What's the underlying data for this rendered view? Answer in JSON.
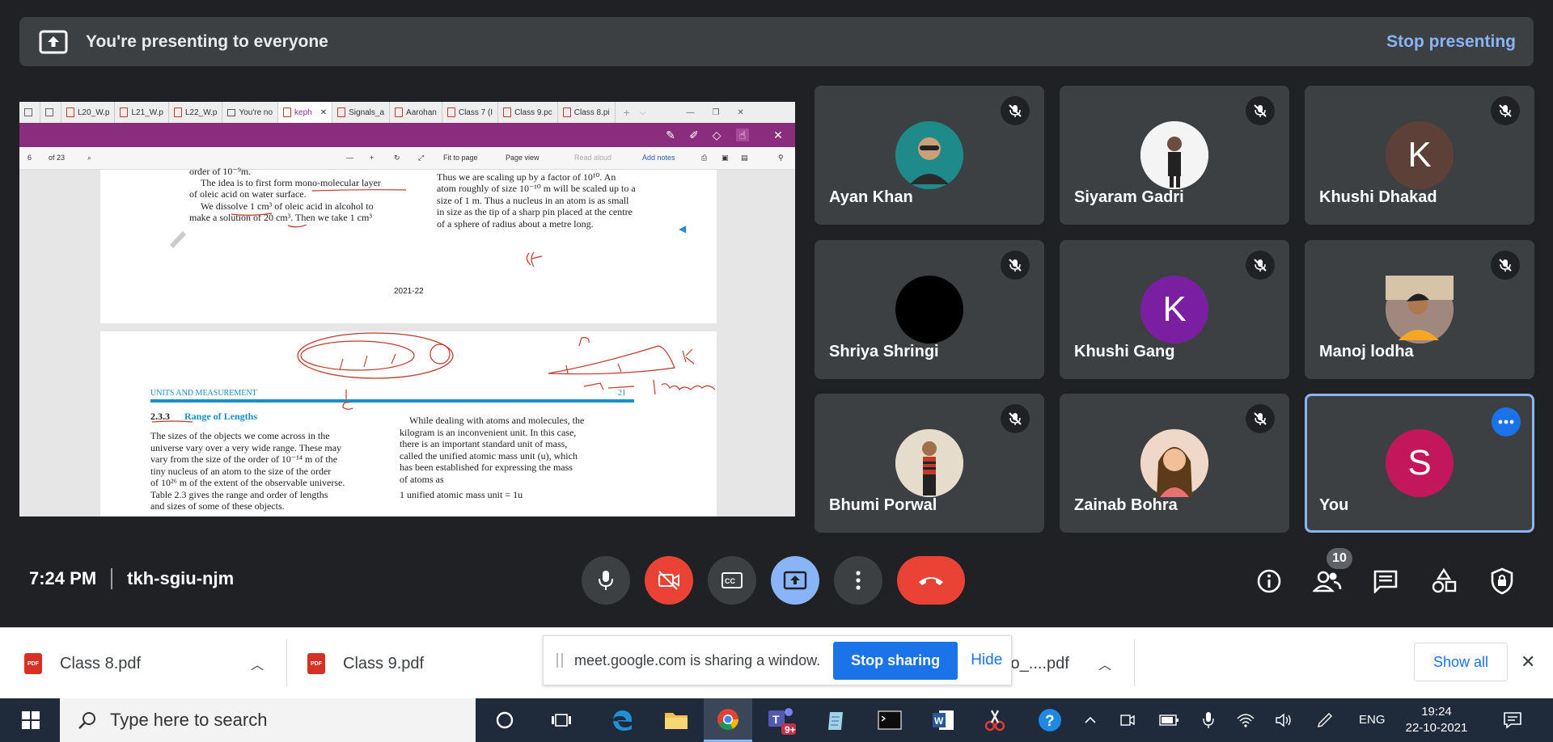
{
  "banner": {
    "title": "You're presenting to everyone",
    "stop_label": "Stop presenting"
  },
  "shared_window": {
    "tabs": [
      "L20_W.p",
      "L21_W.p",
      "L22_W.p",
      "You're no",
      "keph",
      "Signals_a",
      "Aarohan",
      "Class 7 (I",
      "Class 9.pc",
      "Class 8.pi"
    ],
    "active_tab_index": 4,
    "toolbar": {
      "page": "6",
      "of": "of 23",
      "fit": "Fit to page",
      "view": "Page view",
      "read": "Read aloud",
      "notes": "Add notes"
    },
    "page1": {
      "left": [
        "order of 10⁻⁹m.",
        "The idea is to first form mono-molecular layer",
        "of oleic acid on water surface.",
        "We dissolve 1 cm³ of oleic acid in alcohol to",
        "make a solution of 20 cm³. Then we take 1 cm³"
      ],
      "right": [
        "Thus we are scaling up by a factor of 10¹⁰. An",
        "atom roughly of size 10⁻¹⁰ m will be scaled up to a",
        "size of 1 m. Thus a nucleus in an atom is as small",
        "in size as the tip of a sharp pin placed at the centre",
        "of a sphere of radius about a metre long."
      ],
      "footer": "2021-22"
    },
    "page2": {
      "header": "UNITS AND MEASUREMENT",
      "page_num": "21",
      "section": "2.3.3",
      "section_title": "Range of Lengths",
      "left": [
        "The sizes of the objects we come across in the",
        "universe vary over a very wide range. These may",
        "vary from the size of the order of 10⁻¹⁴ m of the",
        "tiny nucleus of an atom to the size of the order",
        "of 10²⁶ m of the extent of the observable universe.",
        "Table 2.3 gives the range and order of lengths",
        "and sizes of some of these objects."
      ],
      "right": [
        "While dealing with atoms and molecules, the",
        "kilogram is an inconvenient unit. In this case,",
        "there is an important standard unit of mass,",
        "called the unified atomic mass unit (u), which",
        "has been established for expressing the mass",
        "of atoms as",
        "1 unified atomic mass unit = 1u"
      ]
    }
  },
  "participants": [
    {
      "name": "Ayan Khan",
      "avatar": "photo",
      "color": "#1e8a8a",
      "muted": true
    },
    {
      "name": "Siyaram Gadri",
      "avatar": "photo",
      "color": "#f4f4f4",
      "muted": true
    },
    {
      "name": "Khushi Dhakad",
      "avatar": "K",
      "color": "#5d4037",
      "muted": true
    },
    {
      "name": "Shriya Shringi",
      "avatar": "photo",
      "color": "#000000",
      "muted": true
    },
    {
      "name": "Khushi Gang",
      "avatar": "K",
      "color": "#7b1fa2",
      "muted": true
    },
    {
      "name": "Manoj lodha",
      "avatar": "photo",
      "color": "#8d6e63",
      "muted": true
    },
    {
      "name": "Bhumi Porwal",
      "avatar": "photo",
      "color": "#d8c8b0",
      "muted": true
    },
    {
      "name": "Zainab Bohra",
      "avatar": "photo",
      "color": "#e0a080",
      "muted": true
    },
    {
      "name": "You",
      "avatar": "S",
      "color": "#c2185b",
      "muted": false
    }
  ],
  "meeting": {
    "time": "7:24 PM",
    "code": "tkh-sgiu-njm",
    "participant_count": "10"
  },
  "downloads": {
    "items": [
      "Class 8.pdf",
      "Class 9.pdf",
      "to_....pdf"
    ],
    "share_message": "meet.google.com is sharing a window.",
    "stop_sharing": "Stop sharing",
    "hide": "Hide",
    "show_all": "Show all"
  },
  "taskbar": {
    "search_placeholder": "Type here to search",
    "teams_badge": "9+",
    "lang": "ENG",
    "time": "19:24",
    "date": "22-10-2021"
  },
  "colors": {
    "accent": "#8ab4f8",
    "danger": "#ea4335",
    "tile": "#3c4043",
    "background": "#202124"
  }
}
